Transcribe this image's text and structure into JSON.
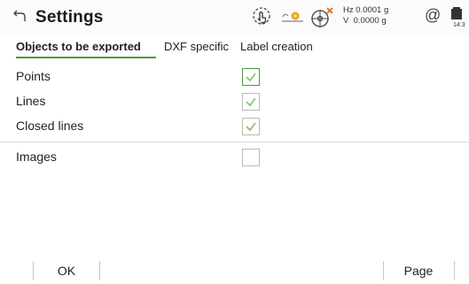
{
  "header": {
    "title": "Settings",
    "readout": {
      "hz_label": "Hz",
      "hz_value": "0.0001 g",
      "v_label": "V",
      "v_value": "0.0000 g"
    },
    "at_symbol": "@",
    "time": "14:3",
    "icons": [
      "back-arrow-icon",
      "touch-icon",
      "prism-icon",
      "target-icon",
      "battery-icon"
    ]
  },
  "tabs": [
    {
      "label": "Objects to be exported",
      "active": true
    },
    {
      "label": "DXF specific",
      "active": false
    },
    {
      "label": "Label creation",
      "active": false
    }
  ],
  "options": [
    {
      "label": "Points",
      "checked": true,
      "focused": true
    },
    {
      "label": "Lines",
      "checked": true,
      "focused": false
    },
    {
      "label": "Closed lines",
      "checked": true,
      "focused": false
    },
    {
      "label": "Images",
      "checked": false,
      "focused": false
    }
  ],
  "softkeys": {
    "ok": "OK",
    "page": "Page"
  },
  "colors": {
    "accent": "#4a9a3a",
    "check": "#8cc27a",
    "prism": "#e8a317",
    "alert": "#e06a1a"
  }
}
